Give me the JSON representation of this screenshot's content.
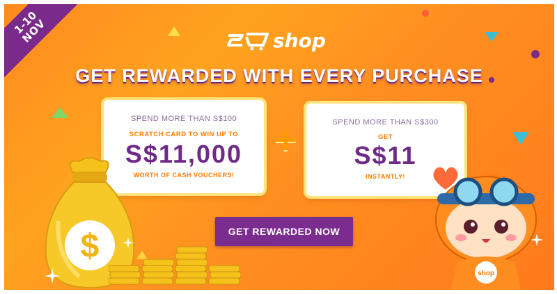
{
  "ribbon": {
    "line1": "1-10",
    "line2": "NOV"
  },
  "logo": {
    "text": "shop"
  },
  "headline": "GET REWARDED WITH EVERY PURCHASE",
  "offer1": {
    "condition": "SPEND MORE THAN S$100",
    "subtitle": "SCRATCH CARD TO WIN UP TO",
    "amount": "S$11,000",
    "footer": "WORTH OF CASH VOUCHERS!"
  },
  "plus_symbol": "+",
  "offer2": {
    "condition": "SPEND MORE THAN S$300",
    "subtitle": "GET",
    "amount": "S$11",
    "footer": "INSTANTLY!"
  },
  "cta_label": "GET REWARDED NOW",
  "moneybag": {
    "symbol": "$"
  },
  "mascot": {
    "shirt_text": "shop"
  },
  "colors": {
    "background": "#ff8f20",
    "brand_purple": "#7b2c8f",
    "accent_orange": "#ff7a00",
    "gold": "#f5c21b"
  }
}
